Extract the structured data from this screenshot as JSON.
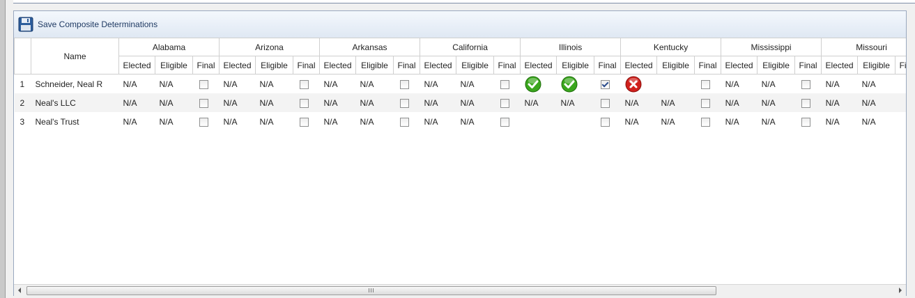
{
  "toolbar": {
    "save_label": "Save Composite Determinations",
    "save_icon": "floppy-disk-icon"
  },
  "grid": {
    "name_header": "Name",
    "sub_headers": [
      "Elected",
      "Eligible",
      "Final"
    ],
    "states": [
      "Alabama",
      "Arizona",
      "Arkansas",
      "California",
      "Illinois",
      "Kentucky",
      "Mississippi",
      "Missouri"
    ],
    "rows": [
      {
        "num": "1",
        "name": "Schneider, Neal R",
        "cells": [
          {
            "elected": "N/A",
            "eligible": "N/A",
            "final": false
          },
          {
            "elected": "N/A",
            "eligible": "N/A",
            "final": false
          },
          {
            "elected": "N/A",
            "eligible": "N/A",
            "final": false
          },
          {
            "elected": "N/A",
            "eligible": "N/A",
            "final": false
          },
          {
            "elected_icon": "check-icon",
            "eligible_icon": "check-icon",
            "final": true
          },
          {
            "elected_icon": "x-icon",
            "eligible": "",
            "final": false
          },
          {
            "elected": "N/A",
            "eligible": "N/A",
            "final": false
          },
          {
            "elected": "N/A",
            "eligible": "N/A"
          }
        ]
      },
      {
        "num": "2",
        "name": "Neal's LLC",
        "cells": [
          {
            "elected": "N/A",
            "eligible": "N/A",
            "final": false
          },
          {
            "elected": "N/A",
            "eligible": "N/A",
            "final": false
          },
          {
            "elected": "N/A",
            "eligible": "N/A",
            "final": false
          },
          {
            "elected": "N/A",
            "eligible": "N/A",
            "final": false
          },
          {
            "elected": "N/A",
            "eligible": "N/A",
            "final": false
          },
          {
            "elected": "N/A",
            "eligible": "N/A",
            "final": false
          },
          {
            "elected": "N/A",
            "eligible": "N/A",
            "final": false
          },
          {
            "elected": "N/A",
            "eligible": "N/A"
          }
        ]
      },
      {
        "num": "3",
        "name": "Neal's Trust",
        "cells": [
          {
            "elected": "N/A",
            "eligible": "N/A",
            "final": false
          },
          {
            "elected": "N/A",
            "eligible": "N/A",
            "final": false
          },
          {
            "elected": "N/A",
            "eligible": "N/A",
            "final": false
          },
          {
            "elected": "N/A",
            "eligible": "N/A",
            "final": false
          },
          {
            "elected": "",
            "eligible": "",
            "final": false
          },
          {
            "elected": "N/A",
            "eligible": "N/A",
            "final": false
          },
          {
            "elected": "N/A",
            "eligible": "N/A",
            "final": false
          },
          {
            "elected": "N/A",
            "eligible": "N/A"
          }
        ]
      }
    ]
  },
  "scrollbar": {
    "grip_label": "III"
  },
  "colors": {
    "header_border": "#cfcfcf",
    "alt_row": "#f3f3f3",
    "toolbar_text": "#1f3a63",
    "check_green": "#3aa61d",
    "x_red": "#d0201c"
  }
}
